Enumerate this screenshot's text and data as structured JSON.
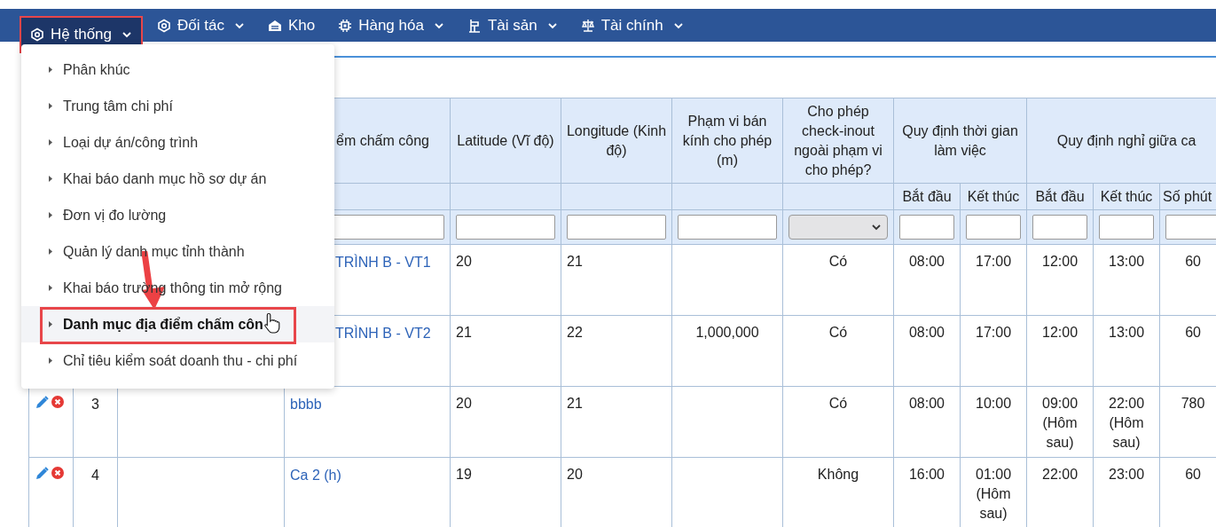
{
  "nav": {
    "items": [
      {
        "label": "Hệ thống",
        "has_menu": true,
        "selected": true
      },
      {
        "label": "Đối tác",
        "has_menu": true,
        "selected": false
      },
      {
        "label": "Kho",
        "has_menu": false,
        "selected": false
      },
      {
        "label": "Hàng hóa",
        "has_menu": true,
        "selected": false
      },
      {
        "label": "Tài sản",
        "has_menu": true,
        "selected": false
      },
      {
        "label": "Tài chính",
        "has_menu": true,
        "selected": false
      }
    ]
  },
  "menu": {
    "items": [
      {
        "label": "Phân khúc",
        "selected": false
      },
      {
        "label": "Trung tâm chi phí",
        "selected": false
      },
      {
        "label": "Loại dự án/công trình",
        "selected": false
      },
      {
        "label": "Khai báo danh mục hồ sơ dự án",
        "selected": false
      },
      {
        "label": "Đơn vị đo lường",
        "selected": false
      },
      {
        "label": "Quản lý danh mục tỉnh thành",
        "selected": false
      },
      {
        "label": "Khai báo trường thông tin mở rộng",
        "selected": false
      },
      {
        "label": "Danh mục địa điểm chấm côn",
        "selected": true
      },
      {
        "label": "Chỉ tiêu kiểm soát doanh thu - chi phí",
        "selected": false
      }
    ]
  },
  "table": {
    "columns": [
      {
        "heading": "ểm chấm công"
      },
      {
        "heading": "Latitude (Vĩ độ)"
      },
      {
        "heading": "Longitude (Kinh độ)"
      },
      {
        "heading": "Phạm vi bán kính cho phép (m)"
      },
      {
        "heading": "Cho phép check-inout ngoài phạm vi cho phép?"
      },
      {
        "heading": "Quy định thời gian làm việc",
        "subheadings": [
          "Bắt đầu",
          "Kết thúc"
        ]
      },
      {
        "heading": "Quy định nghỉ giữa ca",
        "subheadings": [
          "Bắt đầu",
          "Kết thúc",
          "Số phút"
        ]
      }
    ],
    "rows": [
      {
        "name": "TRÌNH B - VT1",
        "latitude": "20",
        "longitude": "21",
        "allow_outside": "Có",
        "work_start": "08:00",
        "work_end": "17:00",
        "break_start": "12:00",
        "break_end": "13:00",
        "break_minutes": "60"
      },
      {
        "name": "TRÌNH B - VT2",
        "latitude": "21",
        "longitude": "22",
        "radius": "1,000,000",
        "allow_outside": "Có",
        "work_start": "08:00",
        "work_end": "17:00",
        "break_start": "12:00",
        "break_end": "13:00",
        "break_minutes": "60"
      },
      {
        "actions": true,
        "index": "3",
        "name": "bbbb",
        "latitude": "20",
        "longitude": "21",
        "allow_outside": "Có",
        "work_start": "08:00",
        "work_end": "10:00",
        "break_start": "09:00 (Hôm sau)",
        "break_end": "22:00 (Hôm sau)",
        "break_minutes": "780"
      },
      {
        "actions": true,
        "index": "4",
        "name": "Ca 2 (h)",
        "latitude": "19",
        "longitude": "20",
        "allow_outside": "Không",
        "work_start": "16:00",
        "work_end": "01:00 (Hôm sau)",
        "break_start": "22:00",
        "break_end": "23:00",
        "break_minutes": "60"
      }
    ]
  }
}
